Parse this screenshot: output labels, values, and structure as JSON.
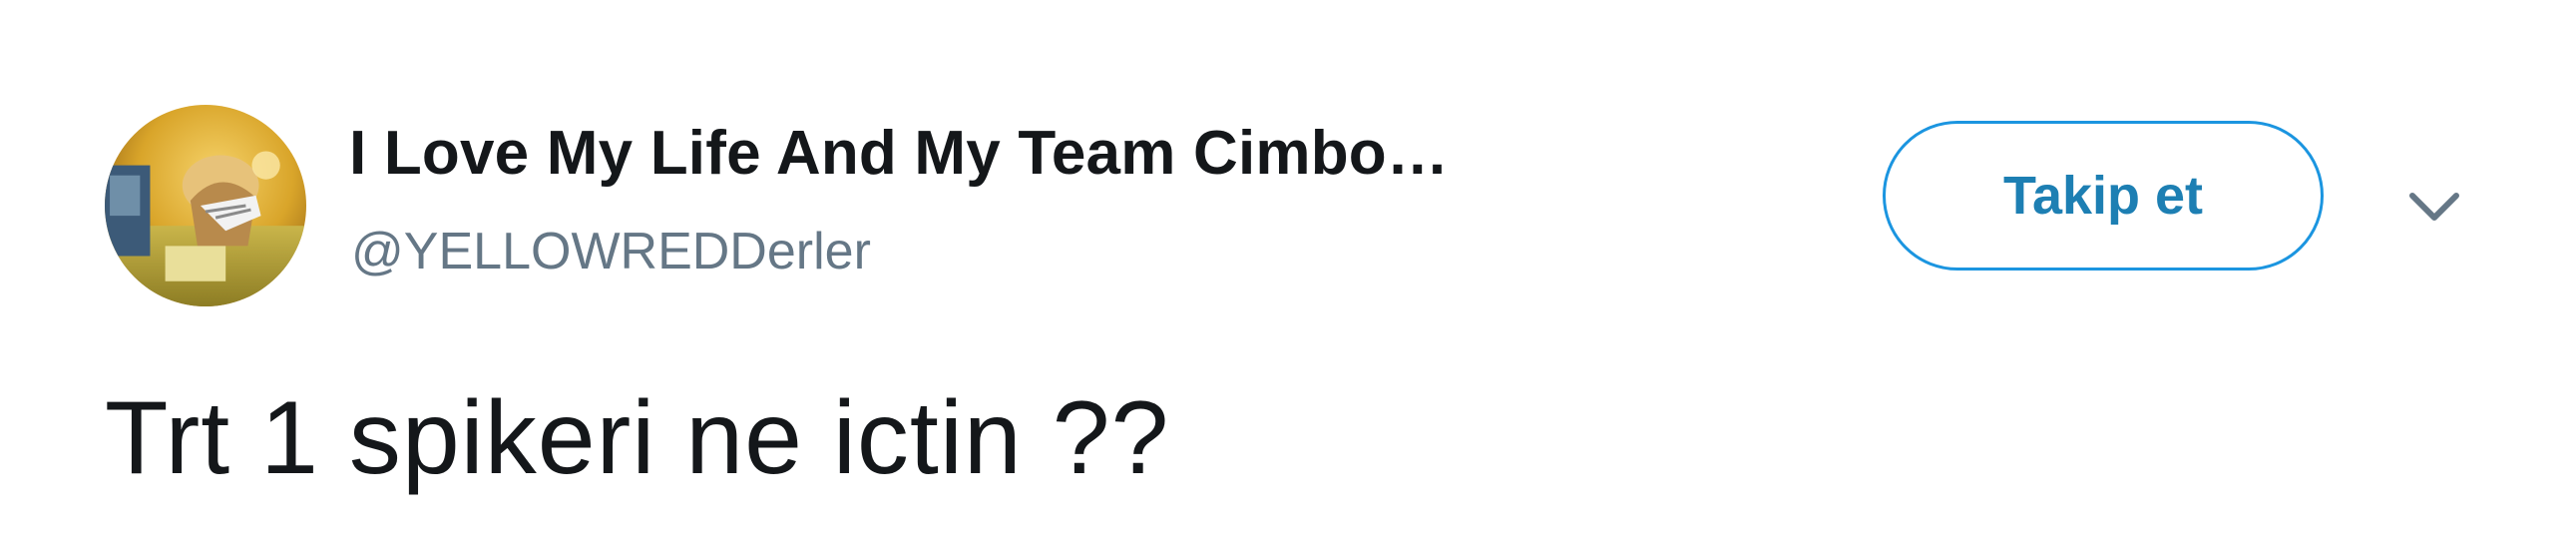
{
  "author": {
    "display_name": "I Love My Life And My Team Cimbo…",
    "handle": "@YELLOWREDDerler",
    "avatar_icon": "profile-avatar"
  },
  "actions": {
    "follow_label": "Takip et",
    "more_icon": "chevron-down-icon"
  },
  "tweet": {
    "text": "Trt 1 spikeri ne ictin ??"
  },
  "colors": {
    "accent": "#1b95e0",
    "name": "#14171a",
    "handle": "#657786",
    "caret": "#657786"
  }
}
